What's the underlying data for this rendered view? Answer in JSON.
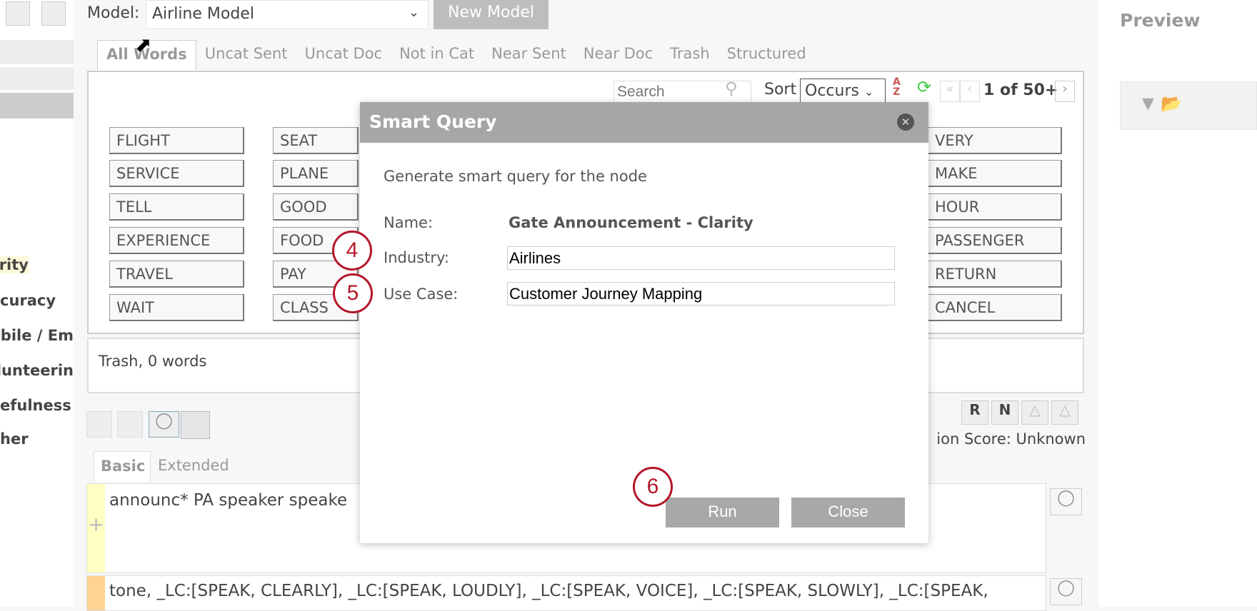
{
  "sidebar": {
    "items": [
      "rity",
      "curacy",
      "obile / Em",
      "lunteerin",
      "efulness",
      "her"
    ]
  },
  "header": {
    "model_label": "Model:",
    "model_value": "Airline Model",
    "new_model": "New Model",
    "preview": "Preview"
  },
  "tabs": [
    "All Words",
    "Uncat Sent",
    "Uncat Doc",
    "Not in Cat",
    "Near Sent",
    "Near Doc",
    "Trash",
    "Structured"
  ],
  "toolbar": {
    "search_placeholder": "Search",
    "sort_label": "Sort",
    "sort_value": "Occurs",
    "page": "1 of 50+"
  },
  "words": {
    "col1": [
      "FLIGHT",
      "SERVICE",
      "TELL",
      "EXPERIENCE",
      "TRAVEL",
      "WAIT"
    ],
    "col2": [
      "SEAT",
      "PLANE",
      "GOOD",
      "FOOD",
      "PAY",
      "CLASS"
    ],
    "col3": [
      "VERY",
      "MAKE",
      "HOUR",
      "PASSENGER",
      "RETURN",
      "CANCEL"
    ]
  },
  "trash_status": "Trash, 0 words",
  "score": "ion Score: Unknown",
  "query_tabs": [
    "Basic",
    "Extended"
  ],
  "query": {
    "row1": "announc* PA speaker speake",
    "row2": "tone, _LC:[SPEAK, CLEARLY], _LC:[SPEAK, LOUDLY], _LC:[SPEAK, VOICE], _LC:[SPEAK, SLOWLY], _LC:[SPEAK,"
  },
  "dialog": {
    "title": "Smart Query",
    "description": "Generate smart query for the node",
    "name_label": "Name:",
    "name_value": "Gate Announcement - Clarity",
    "industry_label": "Industry:",
    "industry_value": "Airlines",
    "usecase_label": "Use Case:",
    "usecase_value": "Customer Journey Mapping",
    "run": "Run",
    "close": "Close"
  },
  "callouts": [
    "4",
    "5",
    "6"
  ]
}
